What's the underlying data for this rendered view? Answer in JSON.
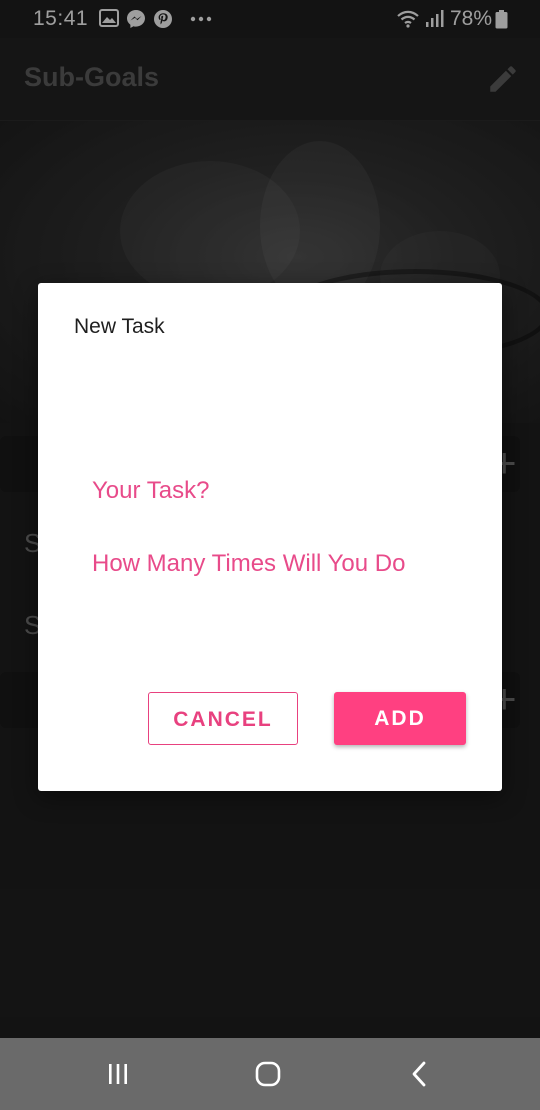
{
  "status_bar": {
    "time": "15:41",
    "notification_icons": [
      "gallery-icon",
      "messenger-icon",
      "pinterest-icon",
      "more-dots-icon"
    ],
    "system_icons": [
      "wifi-icon",
      "signal-icon",
      "battery-icon"
    ],
    "battery": "78%"
  },
  "app_bar": {
    "title": "Sub-Goals",
    "edit_icon": "pencil-icon"
  },
  "dialog": {
    "title": "New Task",
    "task_placeholder": "Your Task?",
    "times_placeholder": "How Many Times Will You Do",
    "cancel_label": "CANCEL",
    "add_label": "ADD",
    "accent_color": "#ff4081"
  },
  "background": {
    "list_initials": [
      "S",
      "S"
    ]
  },
  "nav_bar": {
    "buttons": [
      "recent-apps-icon",
      "home-icon",
      "back-icon"
    ]
  }
}
